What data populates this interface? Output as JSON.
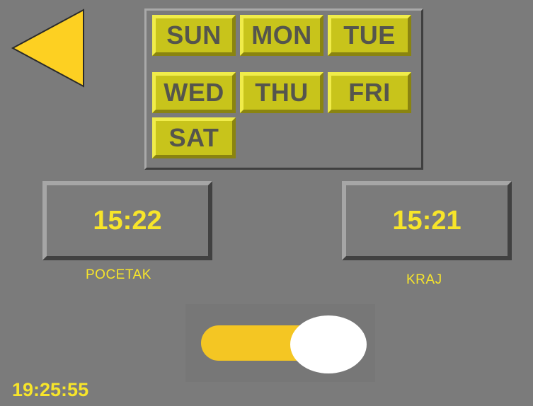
{
  "colors": {
    "background": "#7b7b7b",
    "accent_yellow": "#f7e52a",
    "day_button": "#c8c41b",
    "day_text": "#55554d",
    "toggle_track": "#f4c623",
    "toggle_knob": "#ffffff"
  },
  "back_button": {
    "icon": "triangle-left-icon",
    "color": "#fdd022"
  },
  "days": [
    "SUN",
    "MON",
    "TUE",
    "WED",
    "THU",
    "FRI",
    "SAT"
  ],
  "start": {
    "time": "15:22",
    "label": "POCETAK"
  },
  "end": {
    "time": "15:21",
    "label": "KRAJ"
  },
  "toggle": {
    "state": "on"
  },
  "clock": "19:25:55"
}
